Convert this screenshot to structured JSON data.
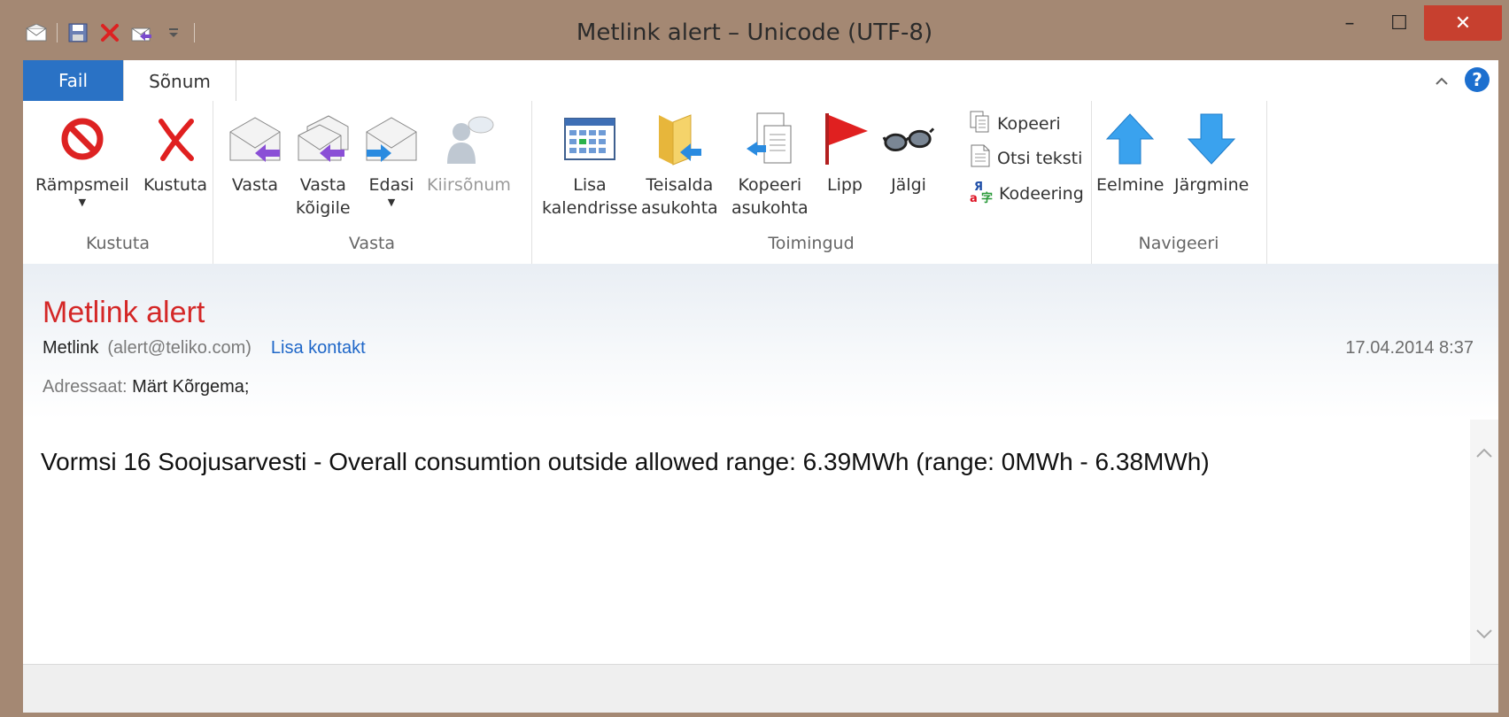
{
  "window": {
    "title": "Metlink alert – Unicode (UTF-8)",
    "minimize": "–",
    "maximize": "☐",
    "close": "✕"
  },
  "tabs": {
    "file": "Fail",
    "message": "Sõnum"
  },
  "ribbon": {
    "groups": {
      "delete": "Kustuta",
      "reply": "Vasta",
      "actions": "Toimingud",
      "navigate": "Navigeeri"
    },
    "buttons": {
      "junk": "Rämpsmeil",
      "delete": "Kustuta",
      "reply": "Vasta",
      "reply_all_1": "Vasta",
      "reply_all_2": "kõigile",
      "forward": "Edasi",
      "im": "Kiirsõnum",
      "add_calendar_1": "Lisa",
      "add_calendar_2": "kalendrisse",
      "move_1": "Teisalda",
      "move_2": "asukohta",
      "copy_to_1": "Kopeeri",
      "copy_to_2": "asukohta",
      "flag": "Lipp",
      "track": "Jälgi",
      "copy": "Kopeeri",
      "find_text": "Otsi teksti",
      "encoding": "Kodeering",
      "previous": "Eelmine",
      "next": "Järgmine"
    }
  },
  "message": {
    "subject": "Metlink alert",
    "from_name": "Metlink",
    "from_address": "(alert@teliko.com)",
    "add_contact": "Lisa kontakt",
    "date": "17.04.2014 8:37",
    "to_label": "Adressaat:",
    "to_value": "Märt Kõrgema;",
    "body": "Vormsi 16 Soojusarvesti - Overall consumtion outside allowed range: 6.39MWh (range: 0MWh - 6.38MWh)"
  },
  "colors": {
    "file_tab": "#2a72c5",
    "subject": "#d42727",
    "link": "#1f67c8",
    "close_button": "#c7402f",
    "frame": "#a48873"
  }
}
